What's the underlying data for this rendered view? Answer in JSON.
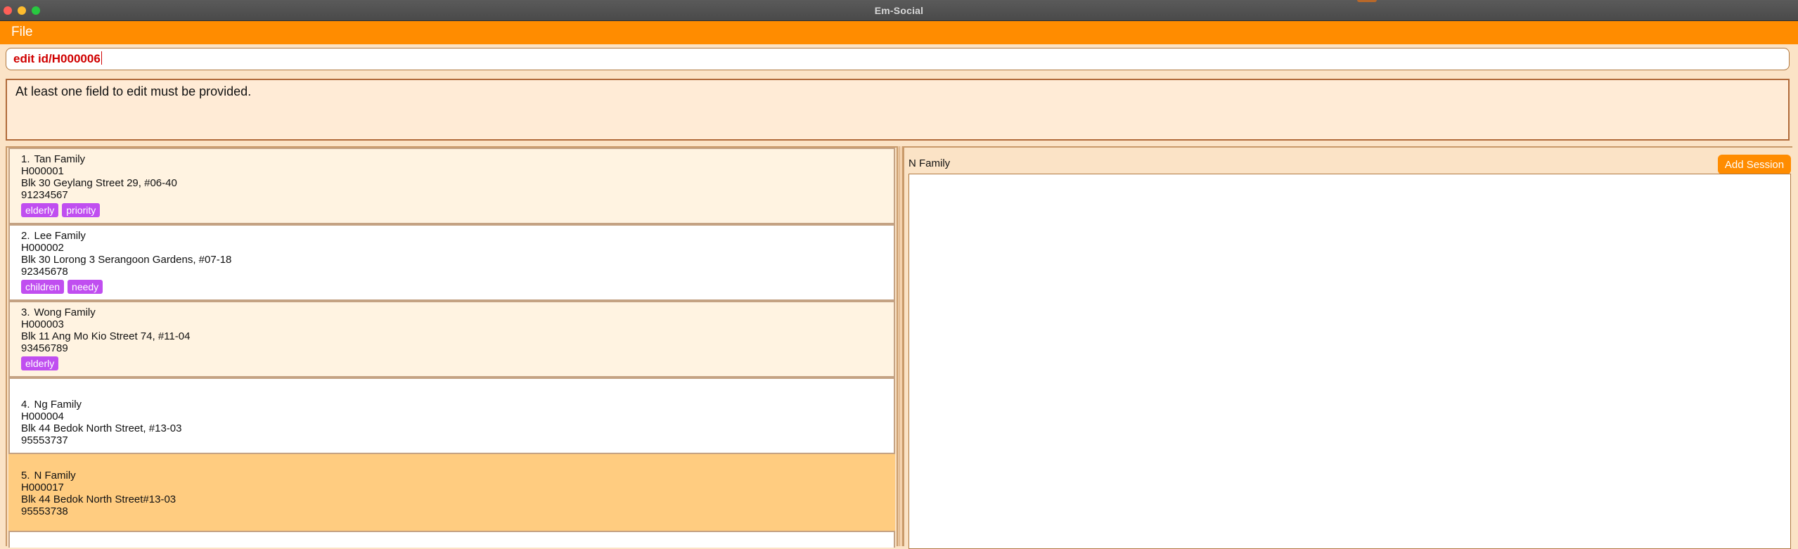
{
  "window": {
    "title": "Em-Social"
  },
  "menu": {
    "file_label": "File"
  },
  "command": {
    "value": "edit id/H000006"
  },
  "result": {
    "message": "At least one field to edit must be provided."
  },
  "households": [
    {
      "index": "1.",
      "name": "Tan Family",
      "id": "H000001",
      "address": "Blk 30 Geylang Street 29, #06-40",
      "phone": "91234567",
      "tags": [
        "elderly",
        "priority"
      ]
    },
    {
      "index": "2.",
      "name": "Lee Family",
      "id": "H000002",
      "address": "Blk 30 Lorong 3 Serangoon Gardens, #07-18",
      "phone": "92345678",
      "tags": [
        "children",
        "needy"
      ]
    },
    {
      "index": "3.",
      "name": "Wong Family",
      "id": "H000003",
      "address": "Blk 11 Ang Mo Kio Street 74, #11-04",
      "phone": "93456789",
      "tags": [
        "elderly"
      ]
    },
    {
      "index": "4.",
      "name": "Ng Family",
      "id": "H000004",
      "address": "Blk 44 Bedok North Street, #13-03",
      "phone": "95553737",
      "tags": []
    },
    {
      "index": "5.",
      "name": "N Family",
      "id": "H000017",
      "address": "Blk 44 Bedok North Street#13-03",
      "phone": "95553738",
      "tags": []
    }
  ],
  "session_panel": {
    "title": "N Family",
    "add_button": "Add Session"
  },
  "colors": {
    "accent": "#ff8c00",
    "tag": "#c04ef0",
    "error_text": "#d00000",
    "selected_card": "#ffcc80"
  }
}
